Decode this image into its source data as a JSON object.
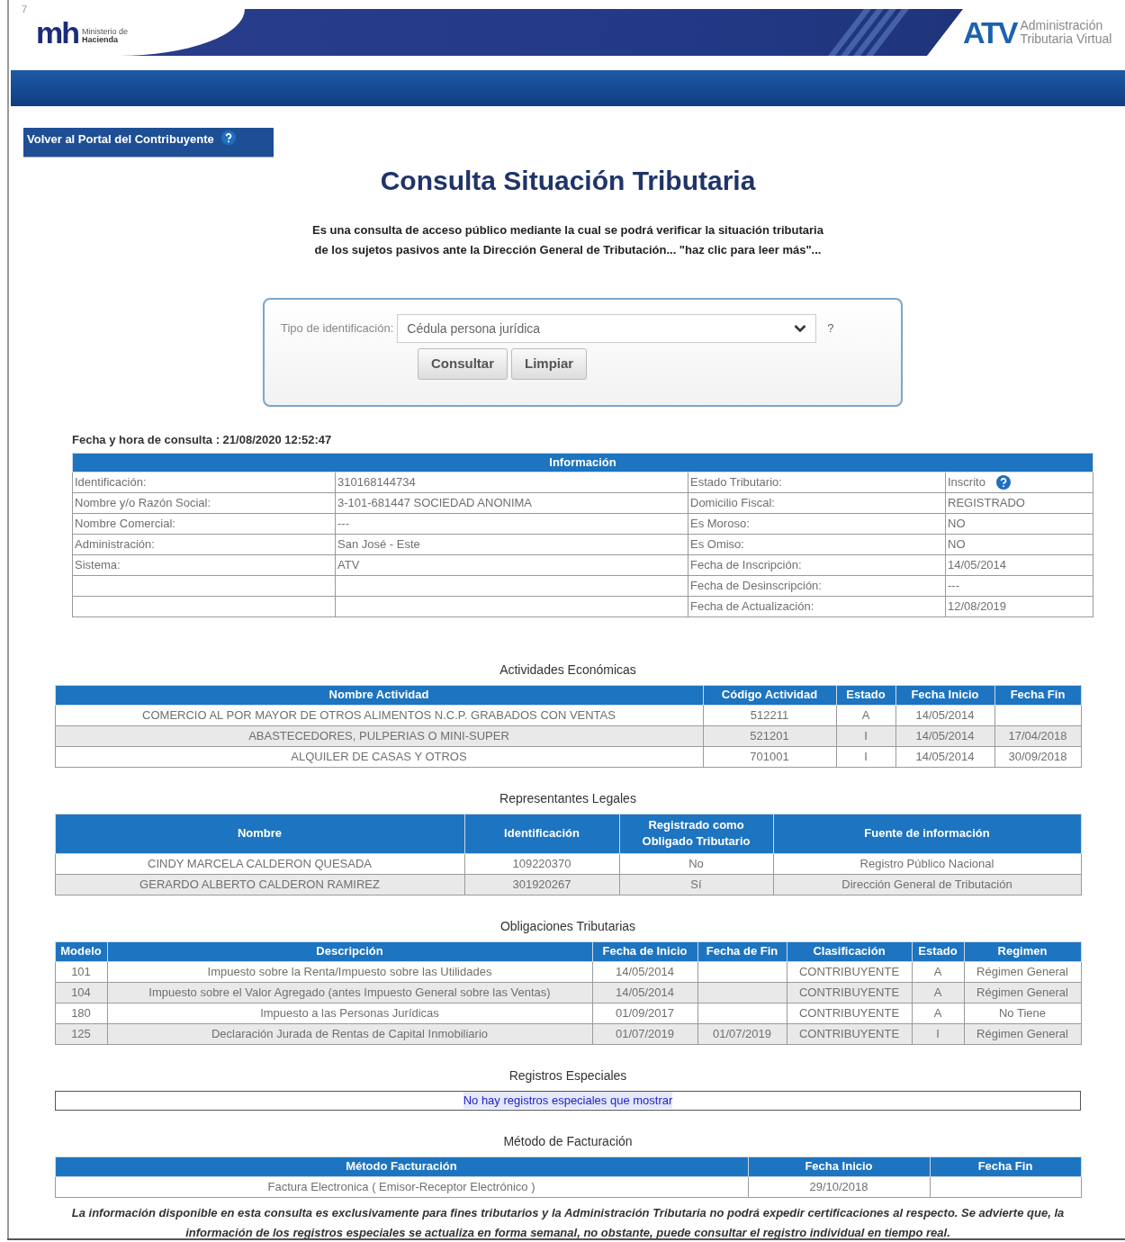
{
  "header": {
    "corner_mark": "7",
    "logo": {
      "mark": "mh",
      "line_1": "Ministerio de",
      "line_2": "Hacienda"
    },
    "atv": {
      "mark": "ATV",
      "line_1": "Administración",
      "line_2": "Tributaria Virtual"
    }
  },
  "back_button": {
    "label": "Volver al Portal del Contribuyente"
  },
  "title": "Consulta Situación Tributaria",
  "intro": [
    "Es una consulta de acceso público mediante la cual se podrá verificar la situación tributaria",
    "de los sujetos pasivos ante la Dirección General de Tributación... \"haz clic para leer más\"..."
  ],
  "form": {
    "label": "Tipo de identificación:",
    "select_value": "Cédula persona jurídica",
    "help": "?",
    "buttons": [
      "Consultar",
      "Limpiar"
    ]
  },
  "query_time": "Fecha y hora de consulta : 21/08/2020 12:52:47",
  "info": {
    "title": "Información",
    "left": [
      {
        "label": "Identificación:",
        "value": "310168144734"
      },
      {
        "label": "Nombre y/o Razón Social:",
        "value": "3-101-681447 SOCIEDAD ANONIMA"
      },
      {
        "label": "Nombre Comercial:",
        "value": "---"
      },
      {
        "label": "Administración:",
        "value": "San José - Este"
      },
      {
        "label": "Sistema:",
        "value": "ATV"
      }
    ],
    "right": [
      {
        "label": "Estado Tributario:",
        "value": "Inscrito",
        "help_icon": true
      },
      {
        "label": "Domicilio Fiscal:",
        "value": "REGISTRADO",
        "help_icon": false
      },
      {
        "label": "Es Moroso:",
        "value": "NO",
        "help_icon": false
      },
      {
        "label": "Es Omiso:",
        "value": "NO",
        "help_icon": false
      },
      {
        "label": "Fecha de Inscripción:",
        "value": "14/05/2014",
        "help_icon": false
      },
      {
        "label": "Fecha de Desinscripción:",
        "value": "---",
        "help_icon": false
      },
      {
        "label": "Fecha de Actualización:",
        "value": "12/08/2019",
        "help_icon": false
      }
    ]
  },
  "activities": {
    "title": "Actividades Económicas",
    "columns": [
      "Nombre Actividad",
      "Código Actividad",
      "Estado",
      "Fecha Inicio",
      "Fecha Fin"
    ],
    "rows": [
      [
        "COMERCIO AL POR MAYOR DE OTROS ALIMENTOS N.C.P. GRABADOS CON VENTAS",
        "512211",
        "A",
        "14/05/2014",
        null
      ],
      [
        "ABASTECEDORES, PULPERIAS O MINI-SUPER",
        "521201",
        "I",
        "14/05/2014",
        "17/04/2018"
      ],
      [
        "ALQUILER DE CASAS Y OTROS",
        "701001",
        "I",
        "14/05/2014",
        "30/09/2018"
      ]
    ]
  },
  "representatives": {
    "title": "Representantes Legales",
    "columns": [
      "Nombre",
      "Identificación",
      "Registrado como Obligado Tributario",
      "Fuente de información"
    ],
    "rows": [
      [
        "CINDY MARCELA CALDERON QUESADA",
        "109220370",
        "No",
        "Registro Público Nacional"
      ],
      [
        "GERARDO ALBERTO CALDERON RAMIREZ",
        "301920267",
        "Sí",
        "Dirección General de Tributación"
      ]
    ]
  },
  "obligations": {
    "title": "Obligaciones Tributarias",
    "columns": [
      "Modelo",
      "Descripción",
      "Fecha de Inicio",
      "Fecha de Fin",
      "Clasificación",
      "Estado",
      "Regimen"
    ],
    "rows": [
      [
        "101",
        "Impuesto sobre la Renta/Impuesto sobre las Utilidades",
        "14/05/2014",
        null,
        "CONTRIBUYENTE",
        "A",
        "Régimen General"
      ],
      [
        "104",
        "Impuesto sobre el Valor Agregado (antes Impuesto General sobre las Ventas)",
        "14/05/2014",
        null,
        "CONTRIBUYENTE",
        "A",
        "Régimen General"
      ],
      [
        "180",
        "Impuesto a las Personas Jurídicas",
        "01/09/2017",
        null,
        "CONTRIBUYENTE",
        "A",
        "No Tiene"
      ],
      [
        "125",
        "Declaración Jurada de Rentas de Capital Inmobiliario",
        "01/07/2019",
        "01/07/2019",
        "CONTRIBUYENTE",
        "I",
        "Régimen General"
      ]
    ]
  },
  "special_records": {
    "title": "Registros Especiales",
    "message": "No hay registros especiales que mostrar"
  },
  "billing": {
    "title": "Método de Facturación",
    "columns": [
      "Método Facturación",
      "Fecha Inicio",
      "Fecha Fin"
    ],
    "rows": [
      [
        "Factura Electronica ( Emisor-Receptor Electrónico )",
        "29/10/2018",
        null
      ]
    ]
  },
  "footer": "La información disponible en esta consulta es exclusivamente para fines tributarios y la Administración Tributaria no podrá expedir certificaciones al respecto. Se advierte que, la información de los registros especiales se actualiza en forma semanal, no obstante, puede consultar el registro individual en tiempo real."
}
